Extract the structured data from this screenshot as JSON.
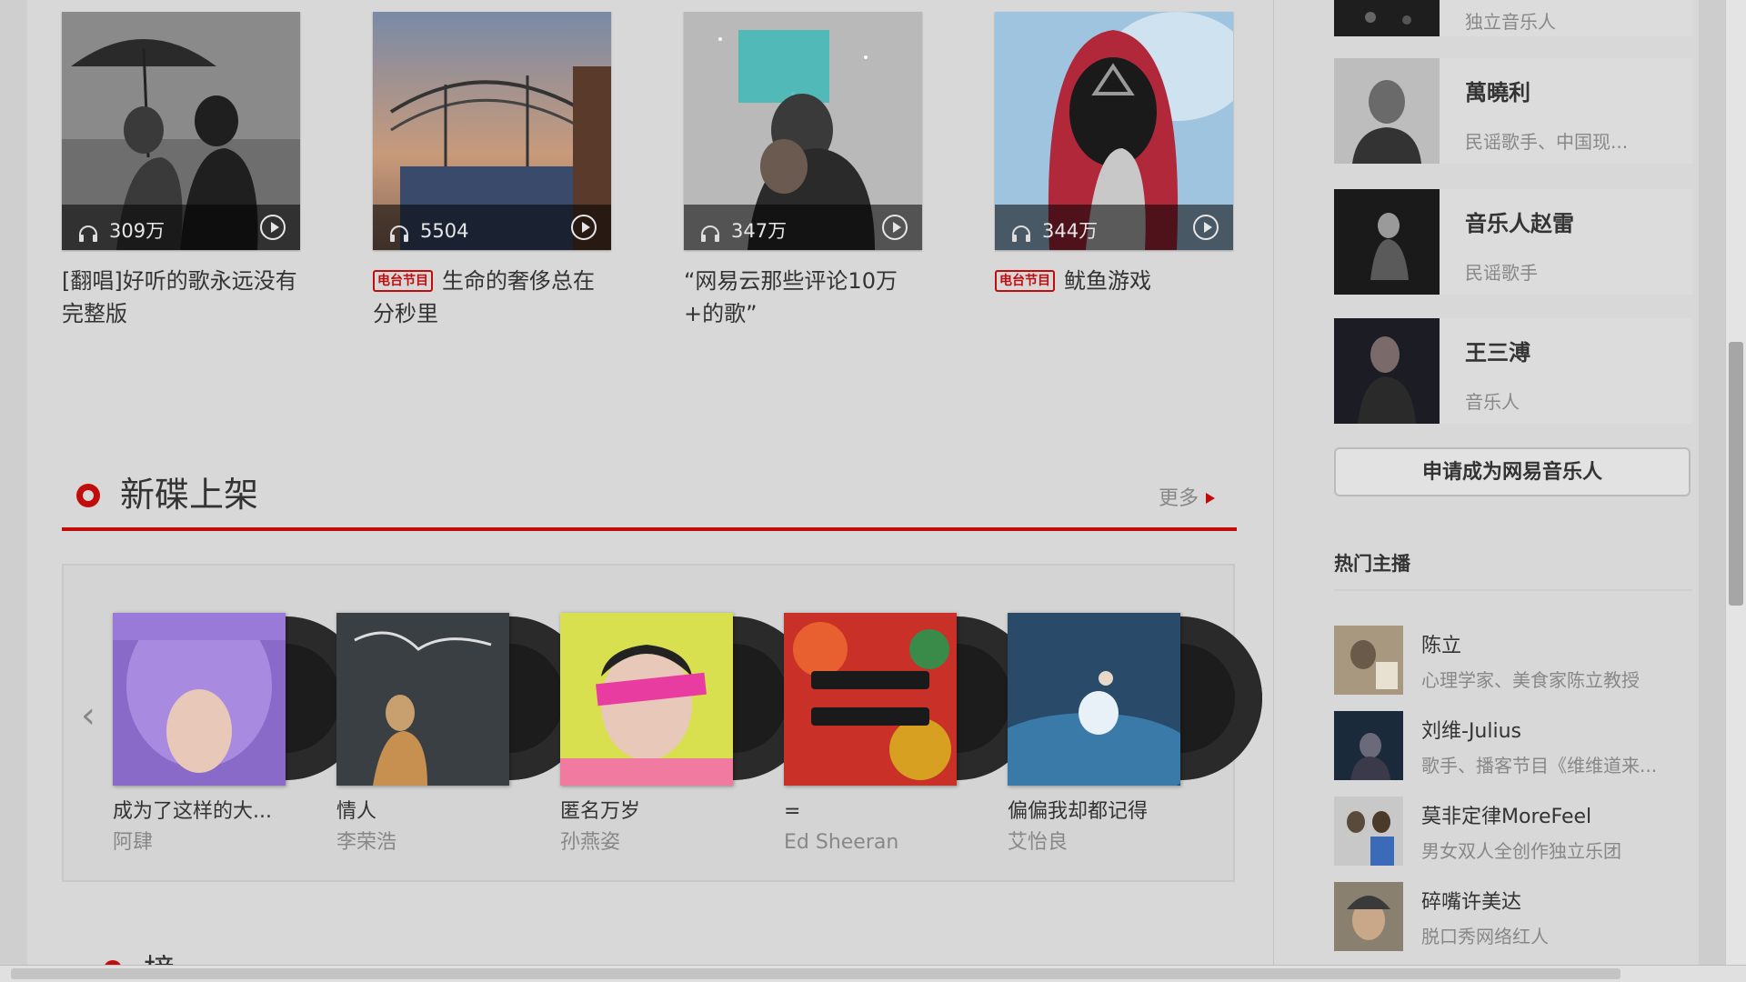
{
  "playlists": [
    {
      "count": "309万",
      "title": "[翻唱]好听的歌永远没有完整版",
      "tag": ""
    },
    {
      "count": "5504",
      "title": "生命的奢侈总在分秒里",
      "tag": "电台节目"
    },
    {
      "count": "347万",
      "title": "“网易云那些评论10万+的歌”",
      "tag": ""
    },
    {
      "count": "344万",
      "title": "鱿鱼游戏",
      "tag": "电台节目"
    }
  ],
  "new_albums": {
    "title": "新碟上架",
    "more": "更多",
    "items": [
      {
        "name": "成为了这样的大...",
        "artist": "阿肆"
      },
      {
        "name": "情人",
        "artist": "李荣浩"
      },
      {
        "name": "匿名万岁",
        "artist": "孙燕姿"
      },
      {
        "name": "=",
        "artist": "Ed Sheeran"
      },
      {
        "name": "偏偏我却都记得",
        "artist": "艾怡良"
      }
    ]
  },
  "next_section": {
    "title": "榜单"
  },
  "sidebar": {
    "top_partial_desc": "独立音乐人",
    "artists": [
      {
        "name": "萬曉利",
        "desc": "民谣歌手、中国现..."
      },
      {
        "name": "音乐人赵雷",
        "desc": "民谣歌手"
      },
      {
        "name": "王三溥",
        "desc": "音乐人"
      }
    ],
    "apply_button": "申请成为网易音乐人",
    "hot_dj_title": "热门主播",
    "djs": [
      {
        "name": "陈立",
        "desc": "心理学家、美食家陈立教授"
      },
      {
        "name": "刘维-Julius",
        "desc": "歌手、播客节目《维维道来..."
      },
      {
        "name": "莫非定律MoreFeel",
        "desc": "男女双人全创作独立乐团"
      },
      {
        "name": "碎嘴许美达",
        "desc": "脱口秀网络红人"
      }
    ]
  },
  "colors": {
    "accent": "#c20c0c"
  }
}
